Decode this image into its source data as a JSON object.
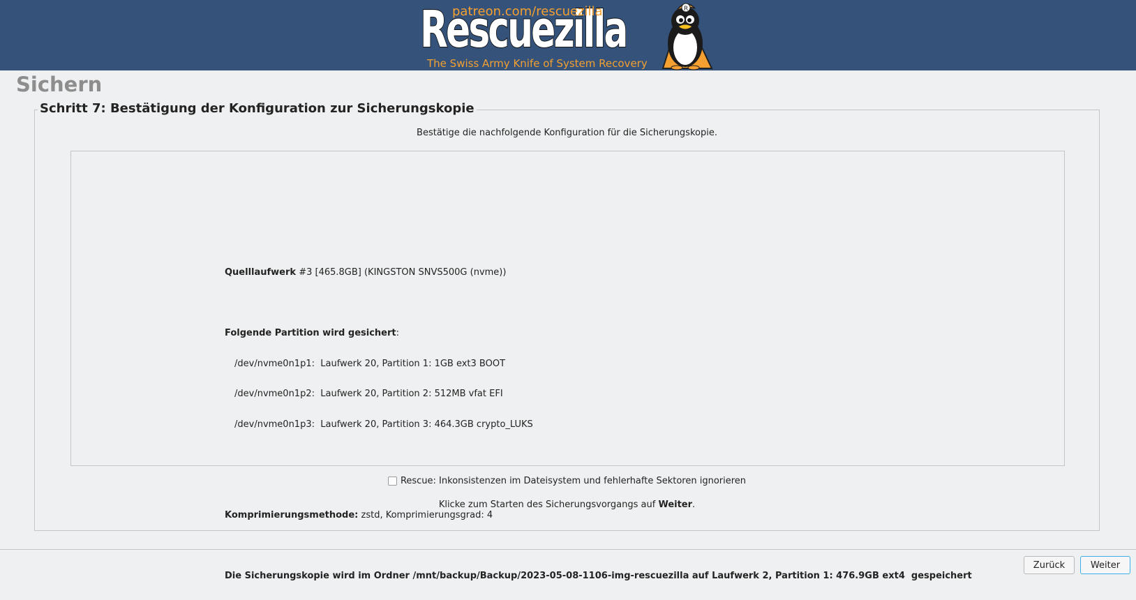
{
  "banner": {
    "patreon": "patreon.com/rescuezilla",
    "wordmark": "Rescuezilla",
    "tagline": "The Swiss Army Knife of System Recovery",
    "colors": {
      "background": "#34527a",
      "accent": "#f5a030"
    }
  },
  "page": {
    "title": "Sichern"
  },
  "step": {
    "legend": "Schritt 7: Bestätigung der Konfiguration zur Sicherungskopie",
    "instruction": "Bestätige die nachfolgende Konfiguration für die Sicherungskopie."
  },
  "summary": {
    "source_label": "Quelllaufwerk",
    "source_value": " #3 [465.8GB] (KINGSTON SNVS500G (nvme))",
    "partitions_label": "Folgende Partition wird gesichert",
    "partitions_colon": ":",
    "partitions": [
      "/dev/nvme0n1p1:  Laufwerk 20, Partition 1: 1GB ext3 BOOT",
      "/dev/nvme0n1p2:  Laufwerk 20, Partition 2: 512MB vfat EFI",
      "/dev/nvme0n1p3:  Laufwerk 20, Partition 3: 464.3GB crypto_LUKS"
    ],
    "compression_label": "Komprimierungsmethode:",
    "compression_value": " zstd, Komprimierungsgrad: 4",
    "destination": "Die Sicherungskopie wird im Ordner /mnt/backup/Backup/2023-05-08-1106-img-rescuezilla auf Laufwerk 2, Partition 1: 476.9GB ext4  gespeichert"
  },
  "rescue": {
    "label": "Rescue: Inkonsistenzen im Dateisystem und fehlerhafte Sektoren ignorieren",
    "checked": false
  },
  "hint": {
    "prefix": "Klicke zum Starten des Sicherungsvorgangs auf ",
    "bold": "Weiter",
    "suffix": "."
  },
  "buttons": {
    "back": "Zurück",
    "next": "Weiter"
  }
}
